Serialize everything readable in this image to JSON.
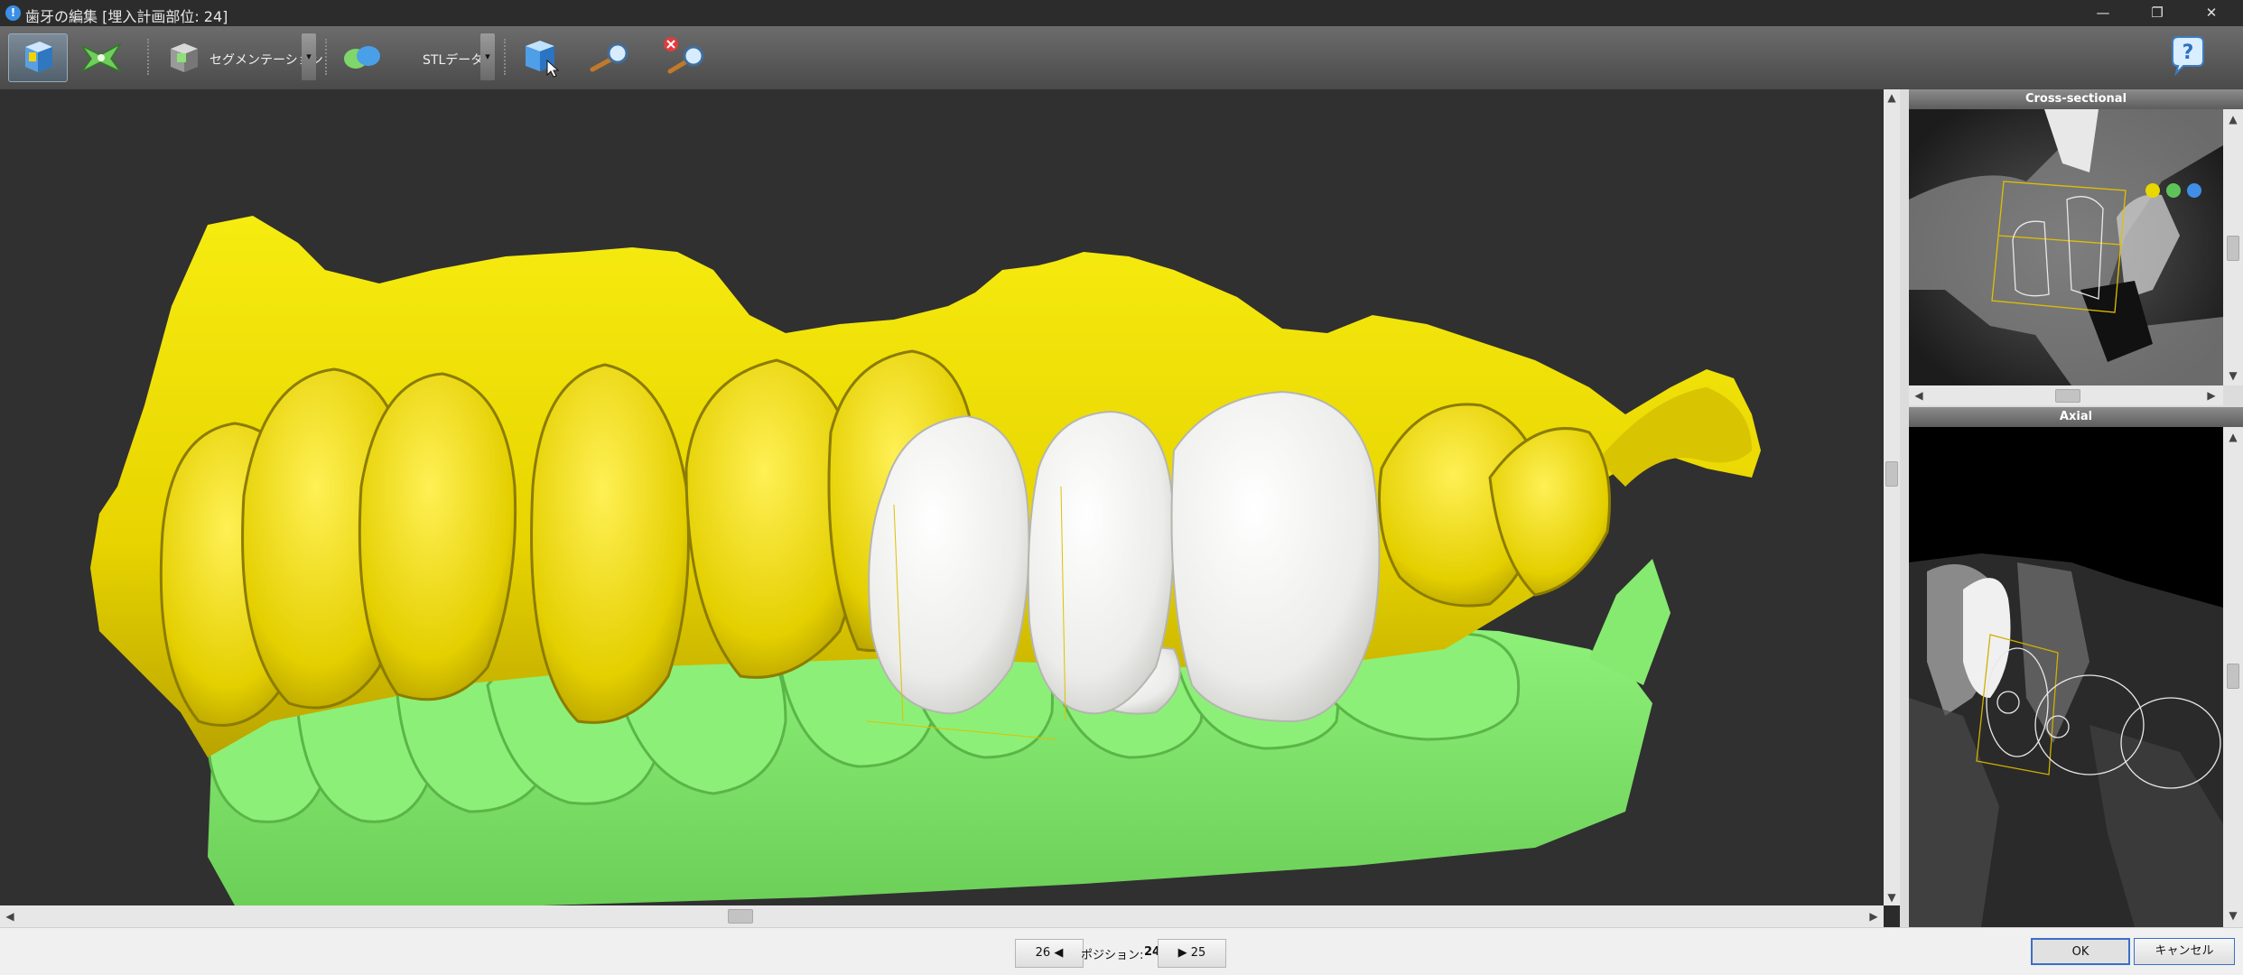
{
  "window": {
    "title": "歯牙の編集 [埋入計画部位: 24]",
    "controls": {
      "minimize": "—",
      "restore": "❐",
      "close": "✕"
    }
  },
  "toolbar": {
    "segmentation_label": "セグメンテーション",
    "stl_label": "STLデータ",
    "dropdown_glyph": "▾",
    "help_glyph": "?"
  },
  "viewport": {
    "colors": {
      "upper_jaw": "#f0e000",
      "lower_jaw": "#88f070",
      "crowns": "#ececea",
      "background": "#303030"
    }
  },
  "panels": {
    "cross_sectional": {
      "title": "Cross-sectional"
    },
    "axial": {
      "title": "Axial"
    }
  },
  "scroll": {
    "up": "▲",
    "down": "▼",
    "left": "◀",
    "right": "▶"
  },
  "bottom": {
    "prev_button": "26 ◀",
    "position_label": "ポジション:",
    "position_value": "24",
    "next_button": "▶ 25",
    "ok": "OK",
    "cancel": "キャンセル"
  }
}
